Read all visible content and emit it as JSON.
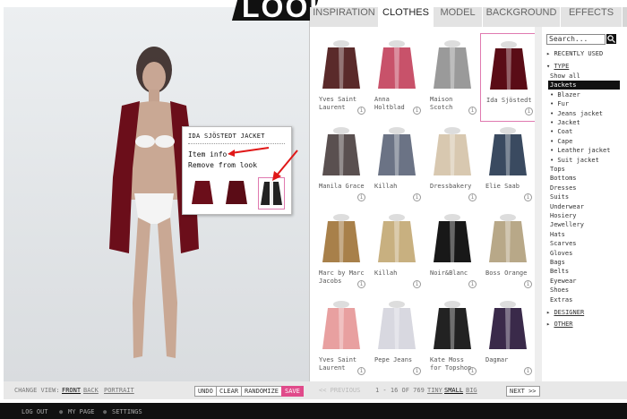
{
  "logo": "LOOK",
  "tabs": [
    "INSPIRATION",
    "CLOTHES",
    "MODEL",
    "BACKGROUND",
    "EFFECTS"
  ],
  "popup": {
    "title": "IDA SJÖSTEDT JACKET",
    "item_info": "Item info",
    "remove": "Remove from look"
  },
  "items": [
    {
      "name": "Yves Saint Laurent",
      "color": "#5a2a2a"
    },
    {
      "name": "Anna Holtblad",
      "color": "#c8526a"
    },
    {
      "name": "Maison Scotch",
      "color": "#9a9a9a"
    },
    {
      "name": "Ida Sjöstedt",
      "color": "#5a0c16"
    },
    {
      "name": "Manila Grace",
      "color": "#5a5050"
    },
    {
      "name": "Killah",
      "color": "#6b7385"
    },
    {
      "name": "Dressbakery",
      "color": "#d8c8b0"
    },
    {
      "name": "Elie Saab",
      "color": "#3a4a60"
    },
    {
      "name": "Marc by Marc Jacobs",
      "color": "#a8804a"
    },
    {
      "name": "Killah",
      "color": "#c8b080"
    },
    {
      "name": "Noir&Blanc",
      "color": "#181818"
    },
    {
      "name": "Boss Orange",
      "color": "#b8a888"
    },
    {
      "name": "Yves Saint Laurent",
      "color": "#e8a0a0"
    },
    {
      "name": "Pepe Jeans",
      "color": "#d8d8e0"
    },
    {
      "name": "Kate Moss for Topshop",
      "color": "#222222"
    },
    {
      "name": "Dagmar",
      "color": "#3a2a4a"
    }
  ],
  "info": "i",
  "search": {
    "value": "Search..."
  },
  "sidebar": {
    "recent": "RECENTLY USED",
    "type": "TYPE",
    "type_items": [
      "Show all",
      "Jackets",
      "• Blazer",
      "• Fur",
      "• Jeans jacket",
      "• Jacket",
      "• Coat",
      "• Cape",
      "• Leather jacket",
      "• Suit jacket",
      "Tops",
      "Bottoms",
      "Dresses",
      "Suits",
      "Underwear",
      "Hosiery",
      "Jewellery",
      "Hats",
      "Scarves",
      "Gloves",
      "Bags",
      "Belts",
      "Eyewear",
      "Shoes",
      "Extras"
    ],
    "designer": "DESIGNER",
    "other": "OTHER"
  },
  "bottom": {
    "change_view": "CHANGE VIEW:",
    "front": "FRONT",
    "back": "BACK",
    "portrait": "PORTRAIT",
    "undo": "UNDO",
    "clear": "CLEAR",
    "randomize": "RANDOMIZE",
    "save": "SAVE",
    "previous": "<< PREVIOUS",
    "pagination": "1 - 16 OF 769",
    "tiny": "TINY",
    "small": "SMALL",
    "big": "BIG",
    "next": "NEXT >>"
  },
  "footer": {
    "logout": "LOG OUT",
    "mypage": "MY PAGE",
    "settings": "SETTINGS"
  },
  "colors": {
    "accent": "#e07ab0",
    "save": "#e04a8a",
    "dark": "#111111"
  }
}
